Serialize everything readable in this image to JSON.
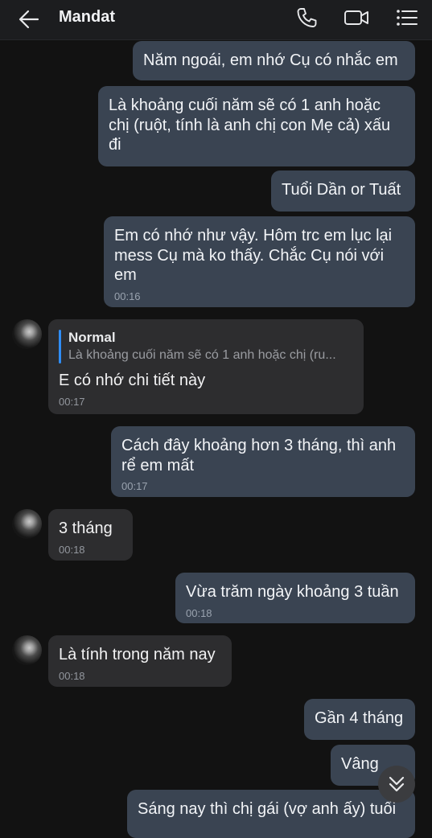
{
  "header": {
    "title": "Mandat"
  },
  "messages": [
    {
      "text": "Năm ngoái, em nhớ Cụ có nhắc em"
    },
    {
      "text": "Là khoảng cuối năm sẽ có 1 anh hoặc chị (ruột, tính là anh chị con Mẹ cả) xấu đi"
    },
    {
      "text": "Tuổi Dần or Tuất"
    },
    {
      "text": "Em có nhớ như vậy. Hôm trc em lục lại mess Cụ mà ko thấy. Chắc Cụ nói với em",
      "time": "00:16"
    },
    {
      "reply_name": "Normal",
      "reply_text": "Là khoảng cuối năm sẽ có 1 anh hoặc chị (ru...",
      "text": "E có nhớ chi tiết này",
      "time": "00:17"
    },
    {
      "text": "Cách đây khoảng hơn 3 tháng, thì anh rể em mất",
      "time": "00:17"
    },
    {
      "text": "3 tháng",
      "time": "00:18"
    },
    {
      "text": "Vừa trăm ngày khoảng 3 tuần",
      "time": "00:18"
    },
    {
      "text": "Là tính trong năm nay",
      "time": "00:18"
    },
    {
      "text": "Gần 4 tháng"
    },
    {
      "text": "Vâng"
    },
    {
      "text": "Sáng nay thì chị gái (vợ anh ấy) tuổi"
    }
  ],
  "icons": {
    "back": "arrow-left-icon",
    "call": "phone-icon",
    "video": "video-camera-icon",
    "menu": "list-menu-icon",
    "scroll": "chevron-double-down-icon"
  },
  "colors": {
    "outgoing_bubble": "#3a4452",
    "incoming_bubble": "#2d2d2f",
    "reply_accent": "#2f8df5",
    "background": "#121212"
  }
}
